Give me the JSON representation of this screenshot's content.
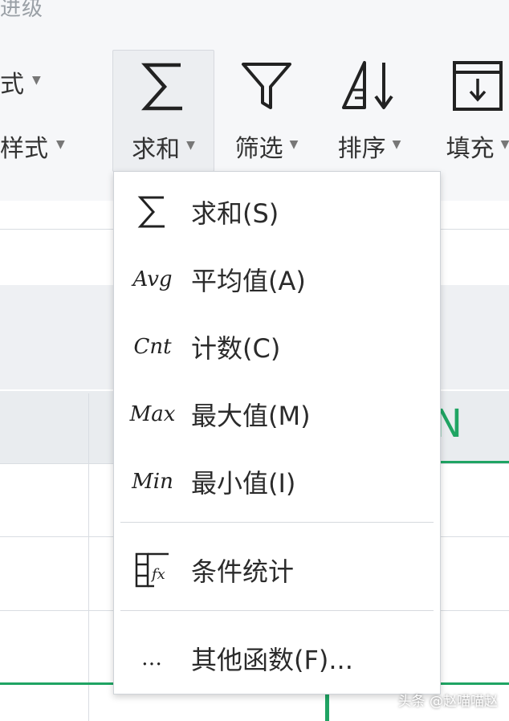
{
  "ribbon": {
    "top_text": "进级",
    "left_labels": [
      "式",
      "样式"
    ],
    "tools": [
      {
        "label": "求和",
        "icon": "sigma-icon"
      },
      {
        "label": "筛选",
        "icon": "funnel-icon"
      },
      {
        "label": "排序",
        "icon": "sort-icon"
      },
      {
        "label": "填充",
        "icon": "fill-icon"
      }
    ]
  },
  "sheet": {
    "column_letter": "N"
  },
  "menu": {
    "items": [
      {
        "icon_text": "Σ",
        "label": "求和(S)"
      },
      {
        "icon_text": "Avg",
        "label": "平均值(A)"
      },
      {
        "icon_text": "Cnt",
        "label": "计数(C)"
      },
      {
        "icon_text": "Max",
        "label": "最大值(M)"
      },
      {
        "icon_text": "Min",
        "label": "最小值(I)"
      }
    ],
    "conditional": {
      "label": "条件统计",
      "icon": "conditional-stats-icon"
    },
    "more": {
      "icon_text": "…",
      "label": "其他函数(F)..."
    }
  },
  "watermark": "头条 @赵喵喵赵",
  "colors": {
    "accent_green": "#1fa463"
  }
}
